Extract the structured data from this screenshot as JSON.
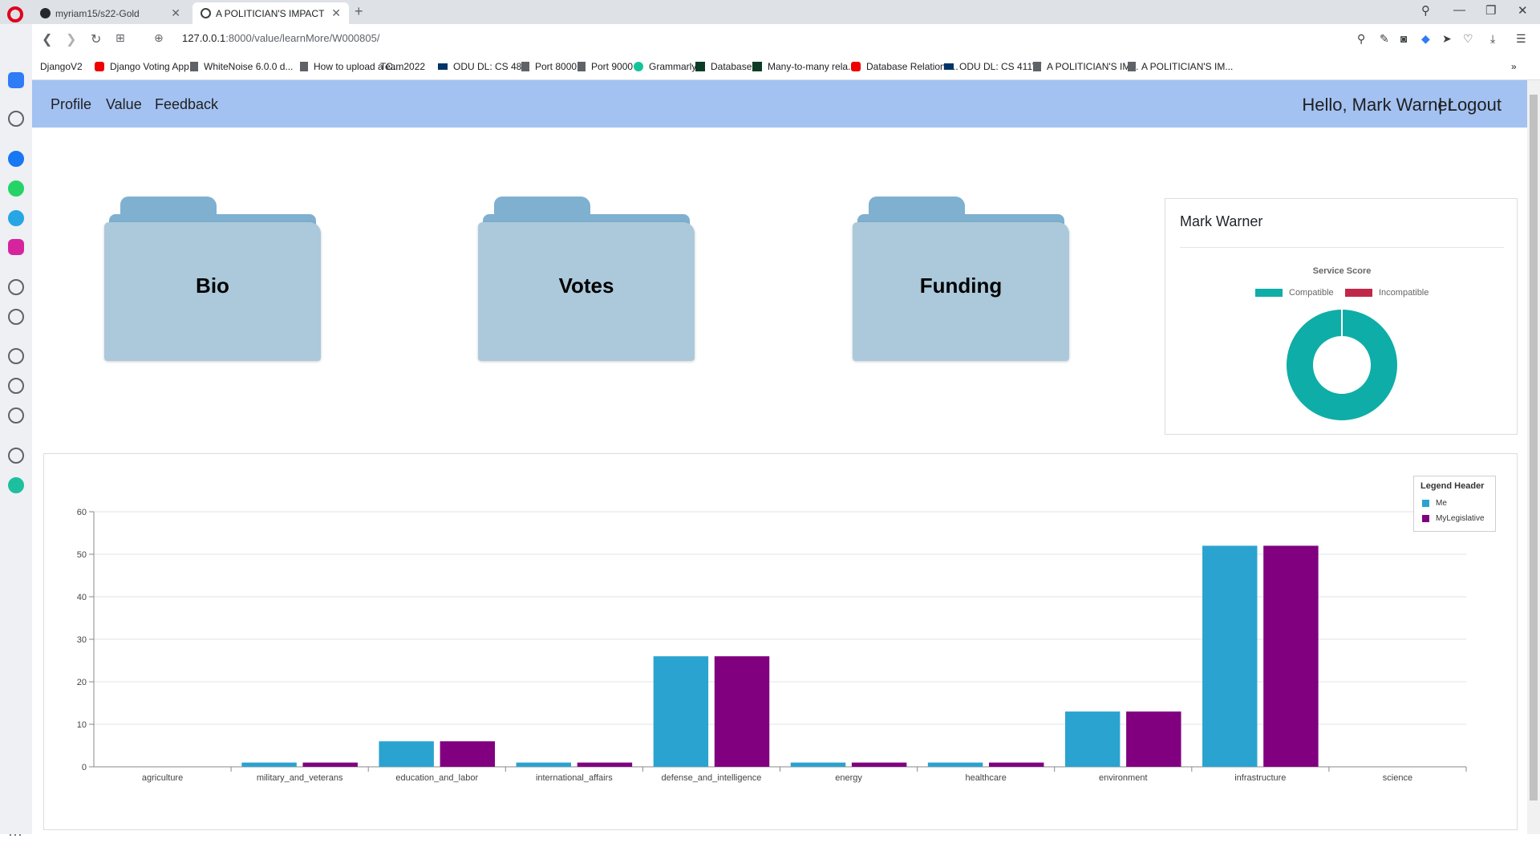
{
  "browser": {
    "tabs": [
      {
        "title": "myriam15/s22-Gold"
      },
      {
        "title": "A POLITICIAN'S IMPACT"
      }
    ],
    "url_host": "127.0.0.1",
    "url_path": ":8000/value/learnMore/W000805/",
    "bookmarks": [
      {
        "label": "DjangoV2",
        "icon": "folder"
      },
      {
        "label": "Django Voting App...",
        "icon": "yt"
      },
      {
        "label": "WhiteNoise 6.0.0 d...",
        "icon": "doc"
      },
      {
        "label": "How to upload a C...",
        "icon": "doc"
      },
      {
        "label": "Team2022",
        "icon": "folder"
      },
      {
        "label": "ODU DL: CS 480",
        "icon": "odu"
      },
      {
        "label": "Port 8000",
        "icon": "doc"
      },
      {
        "label": "Port 9000",
        "icon": "doc"
      },
      {
        "label": "Grammarly",
        "icon": "gram"
      },
      {
        "label": "Database",
        "icon": "dj"
      },
      {
        "label": "Many-to-many rela...",
        "icon": "dj"
      },
      {
        "label": "Database Relations...",
        "icon": "yt"
      },
      {
        "label": "ODU DL: CS 411W",
        "icon": "odu"
      },
      {
        "label": "A POLITICIAN'S IM...",
        "icon": "doc"
      },
      {
        "label": "A POLITICIAN'S IM...",
        "icon": "doc"
      }
    ]
  },
  "navbar": {
    "links": [
      "Profile",
      "Value",
      "Feedback"
    ],
    "greeting": "Hello, Mark Warner",
    "logout": "| Logout"
  },
  "folders": [
    "Bio",
    "Votes",
    "Funding"
  ],
  "score_card": {
    "name": "Mark Warner",
    "chart_title": "Service Score",
    "legend": [
      {
        "label": "Compatible",
        "color": "#0fada7"
      },
      {
        "label": "Incompatible",
        "color": "#c0284a"
      }
    ]
  },
  "bar_legend": {
    "header": "Legend Header",
    "items": [
      {
        "label": "Me",
        "color": "#2ba3d0"
      },
      {
        "label": "MyLegislative",
        "color": "#800080"
      }
    ]
  },
  "chart_data": [
    {
      "type": "pie",
      "title": "Service Score",
      "donut": true,
      "categories": [
        "Compatible",
        "Incompatible"
      ],
      "values": [
        100,
        0
      ],
      "colors": [
        "#0fada7",
        "#c0284a"
      ],
      "legend_position": "top"
    },
    {
      "type": "bar",
      "categories": [
        "agriculture",
        "military_and_veterans",
        "education_and_labor",
        "international_affairs",
        "defense_and_intelligence",
        "energy",
        "healthcare",
        "environment",
        "infrastructure",
        "science"
      ],
      "series": [
        {
          "name": "Me",
          "color": "#2ba3d0",
          "values": [
            0,
            1,
            6,
            1,
            26,
            1,
            1,
            13,
            52,
            0
          ]
        },
        {
          "name": "MyLegislative",
          "color": "#800080",
          "values": [
            0,
            1,
            6,
            1,
            26,
            1,
            1,
            13,
            52,
            0
          ]
        }
      ],
      "ylim": [
        0,
        60
      ],
      "yticks": [
        0,
        10,
        20,
        30,
        40,
        50,
        60
      ],
      "grid": true,
      "legend_title": "Legend Header",
      "legend_position": "top-right"
    }
  ]
}
